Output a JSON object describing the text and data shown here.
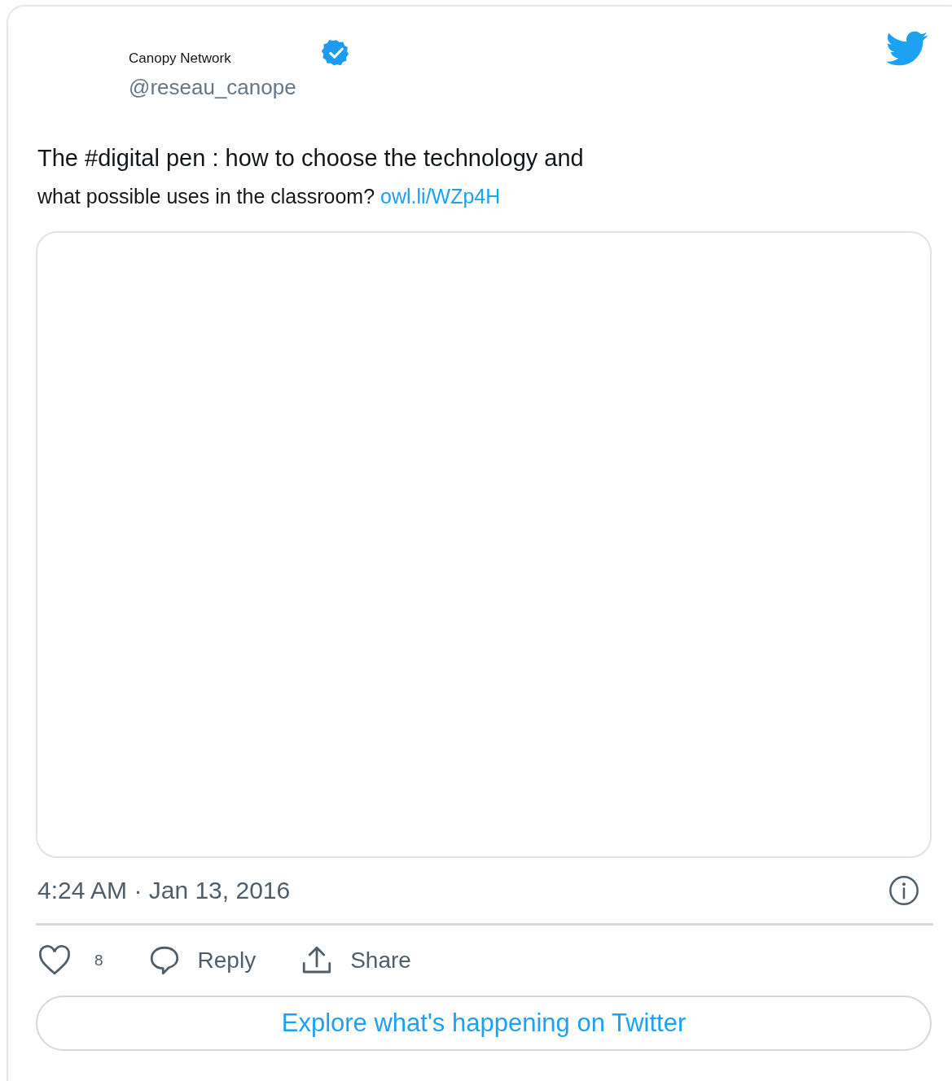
{
  "author": {
    "name": "Canopy Network",
    "handle": "@reseau_canope",
    "verified": true
  },
  "tweet": {
    "line_1": "The #digital pen : how to choose the technology and",
    "line_2": "what possible uses in the classroom?",
    "link": "owl.li/WZp4H"
  },
  "timestamp": "4:24 AM · Jan 13, 2016",
  "actions": [
    {
      "kind": "like",
      "label": "8"
    },
    {
      "kind": "reply",
      "label": "Reply"
    },
    {
      "kind": "share",
      "label": "Share"
    }
  ],
  "explore_button": "Explore what's happening on Twitter"
}
